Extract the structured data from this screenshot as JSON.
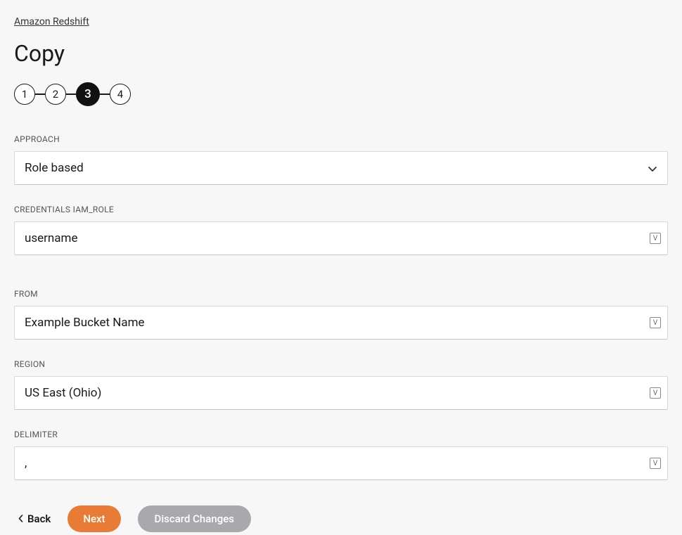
{
  "breadcrumb": "Amazon Redshift",
  "title": "Copy",
  "stepper": {
    "steps": [
      "1",
      "2",
      "3",
      "4"
    ],
    "activeIndex": 2
  },
  "fields": {
    "approach": {
      "label": "APPROACH",
      "value": "Role based"
    },
    "credentials": {
      "label": "CREDENTIALS IAM_ROLE",
      "value": "username"
    },
    "from": {
      "label": "FROM",
      "value": "Example Bucket Name"
    },
    "region": {
      "label": "REGION",
      "value": "US East (Ohio)"
    },
    "delimiter": {
      "label": "DELIMITER",
      "value": ","
    }
  },
  "buttons": {
    "back": "Back",
    "next": "Next",
    "discard": "Discard Changes"
  },
  "varBadge": "V"
}
